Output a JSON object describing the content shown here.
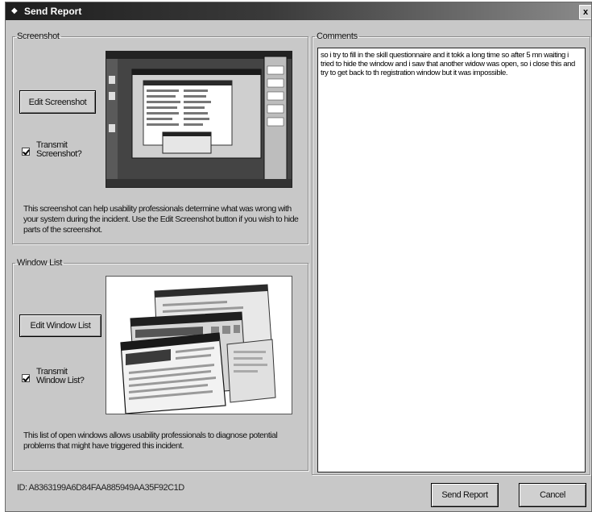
{
  "window": {
    "title": "Send Report",
    "close_glyph": "x"
  },
  "screenshot_group": {
    "legend": "Screenshot",
    "edit_button": "Edit Screenshot",
    "transmit_label_line1": "Transmit",
    "transmit_label_line2": "Screenshot?",
    "transmit_checked": true,
    "description": "This screenshot can help usability professionals determine what was wrong with your system during the incident. Use the Edit Screenshot button if you wish to hide parts of the screenshot."
  },
  "window_list_group": {
    "legend": "Window List",
    "edit_button": "Edit Window List",
    "transmit_label_line1": "Transmit",
    "transmit_label_line2": "Window List?",
    "transmit_checked": true,
    "description": "This list of open windows allows usability professionals to diagnose potential problems that might have triggered this incident."
  },
  "comments_group": {
    "legend": "Comments",
    "value": "so i try to fill in the skill questionnaire and it tokk a long time so after 5 mn waiting i tried to hide the window and i saw that another widow was open, so i close this and try to get back to th registration window but it was impossible."
  },
  "footer": {
    "id_text": "ID: A8363199A6D84FAA885949AA35F92C1D",
    "send_button": "Send Report",
    "cancel_button": "Cancel"
  },
  "colors": {
    "titlebar": "#1e1e1e",
    "dialog_bg": "#c8c8c8",
    "thumb_desktop": "#3f3f3f"
  }
}
